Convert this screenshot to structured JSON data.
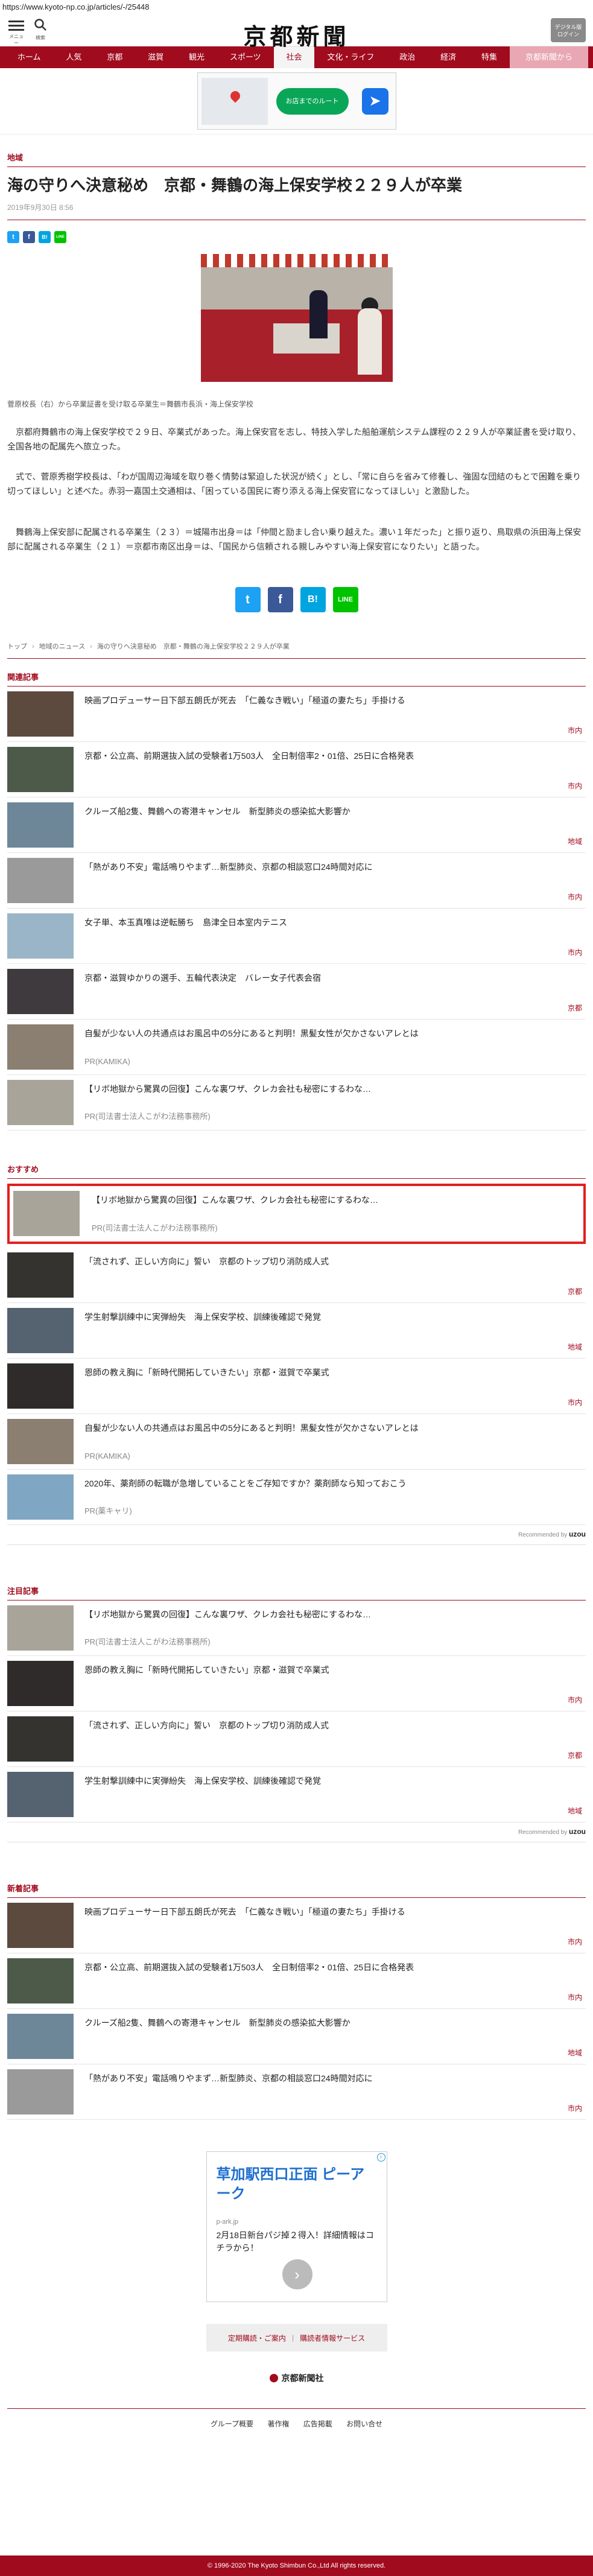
{
  "url": "https://www.kyoto-np.co.jp/articles/-/25448",
  "header": {
    "menu_label": "メニュー",
    "search_label": "検索",
    "logo": "京都新聞",
    "digital_label_1": "デジタル版",
    "digital_label_2": "ログイン"
  },
  "nav": [
    "ホーム",
    "人気",
    "京都",
    "滋賀",
    "観光",
    "スポーツ",
    "社会",
    "文化・ライフ",
    "政治",
    "経済",
    "特集",
    "京都新聞から"
  ],
  "ad_top": {
    "pill": "お店までのルート",
    "map_label": "スマートフォン"
  },
  "article": {
    "category": "地域",
    "title": "海の守りへ決意秘め　京都・舞鶴の海上保安学校２２９人が卒業",
    "date": "2019年9月30日 8:56",
    "caption": "菅原校長（右）から卒業証書を受け取る卒業生＝舞鶴市長浜・海上保安学校",
    "paragraphs": [
      "京都府舞鶴市の海上保安学校で２９日、卒業式があった。海上保安官を志し、特技入学した船舶運航システム課程の２２９人が卒業証書を受け取り、全国各地の配属先へ旅立った。",
      "式で、菅原秀樹学校長は、「わが国周辺海域を取り巻く情勢は緊迫した状況が続く」とし、「常に自らを省みて修養し、強固な団結のもとで困難を乗り切ってほしい」と述べた。赤羽一嘉国土交通相は、「困っている国民に寄り添える海上保安官になってほしい」と激励した。",
      "舞鶴海上保安部に配属される卒業生（２３）＝城陽市出身＝は「仲間と励まし合い乗り越えた。濃い１年だった」と振り返り、鳥取県の浜田海上保安部に配属される卒業生（２１）＝京都市南区出身＝は、「国民から信頼される親しみやすい海上保安官になりたい」と語った。"
    ]
  },
  "share": {
    "twitter": "t",
    "facebook": "f",
    "hatena": "B!",
    "line": "LINE"
  },
  "breadcrumb": [
    "トップ",
    "地域のニュース",
    "海の守りへ決意秘め　京都・舞鶴の海上保安学校２２９人が卒業"
  ],
  "related": {
    "heading": "関連記事",
    "items": [
      {
        "title": "映画プロデューサー日下部五朗氏が死去　「仁義なき戦い」「極道の妻たち」手掛ける",
        "tag": "市内"
      },
      {
        "title": "京都・公立高、前期選抜入試の受験者1万503人　全日制倍率2・01倍、25日に合格発表",
        "tag": "市内"
      },
      {
        "title": "クルーズ船2隻、舞鶴への寄港キャンセル　新型肺炎の感染拡大影響か",
        "tag": "地域"
      },
      {
        "title": "「熱があり不安」電話鳴りやまず…新型肺炎、京都の相談窓口24時間対応に",
        "tag": "市内"
      },
      {
        "title": "女子単、本玉真唯は逆転勝ち　島津全日本室内テニス",
        "tag": "市内"
      },
      {
        "title": "京都・滋賀ゆかりの選手、五輪代表決定　バレー女子代表会宿",
        "tag": "京都"
      },
      {
        "title": "自髪が少ない人の共通点はお風呂中の5分にあると判明！黒髪女性が欠かさないアレとは",
        "pr": "PR(KAMIKA)"
      },
      {
        "title": "【リボ地獄から驚異の回復】こんな裏ワザ、クレカ会社も秘密にするわな…",
        "pr": "PR(司法書士法人こがわ法務事務所)"
      }
    ]
  },
  "recommend": {
    "heading": "おすすめ",
    "items": [
      {
        "title": "【リボ地獄から驚異の回復】こんな裏ワザ、クレカ会社も秘密にするわな…",
        "pr": "PR(司法書士法人こがわ法務事務所)"
      },
      {
        "title": "「流されず、正しい方向に」誓い　京都のトップ切り消防成人式",
        "tag": "京都"
      },
      {
        "title": "学生射撃訓練中に実弾紛失　海上保安学校、訓練後確認で発覚",
        "tag": "地域"
      },
      {
        "title": "恩師の教え胸に「新時代開拓していきたい」京都・滋賀で卒業式",
        "tag": "市内"
      },
      {
        "title": "自髪が少ない人の共通点はお風呂中の5分にあると判明！黒髪女性が欠かさないアレとは",
        "pr": "PR(KAMIKA)"
      },
      {
        "title": "2020年、薬剤師の転職が急増していることをご存知ですか？薬剤師なら知っておこう",
        "pr": "PR(薬キャリ)"
      }
    ],
    "credit": "Recommended by",
    "brand": "uzou"
  },
  "attention": {
    "heading": "注目記事",
    "items": [
      {
        "title": "【リボ地獄から驚異の回復】こんな裏ワザ、クレカ会社も秘密にするわな…",
        "pr": "PR(司法書士法人こがわ法務事務所)"
      },
      {
        "title": "恩師の教え胸に「新時代開拓していきたい」京都・滋賀で卒業式",
        "tag": "市内"
      },
      {
        "title": "「流されず、正しい方向に」誓い　京都のトップ切り消防成人式",
        "tag": "京都"
      },
      {
        "title": "学生射撃訓練中に実弾紛失　海上保安学校、訓練後確認で発覚",
        "tag": "地域"
      }
    ],
    "credit": "Recommended by",
    "brand": "uzou"
  },
  "latest": {
    "heading": "新着記事",
    "items": [
      {
        "title": "映画プロデューサー日下部五朗氏が死去　「仁義なき戦い」「極道の妻たち」手掛ける",
        "tag": "市内"
      },
      {
        "title": "京都・公立高、前期選抜入試の受験者1万503人　全日制倍率2・01倍、25日に合格発表",
        "tag": "市内"
      },
      {
        "title": "クルーズ船2隻、舞鶴への寄港キャンセル　新型肺炎の感染拡大影響か",
        "tag": "地域"
      },
      {
        "title": "「熱があり不安」電話鳴りやまず…新型肺炎、京都の相談窓口24時間対応に",
        "tag": "市内"
      }
    ]
  },
  "ad_bottom": {
    "headline": "草加駅西口正面 ピーアーク",
    "small": "p-ark.jp",
    "desc": "2月18日新台パジ掉２得入！詳細情報はコチラから！",
    "arrow": "›",
    "adchoice": "i"
  },
  "footer": {
    "links": [
      "定期購読・ご案内",
      "購読者情報サービス"
    ],
    "separator": "|",
    "company": "京都新聞社",
    "nav": [
      "グループ概要",
      "著作権",
      "広告掲載",
      "お問い合せ"
    ],
    "copyright": "© 1996-2020 The Kyoto Shimbun Co.,Ltd All rights reserved."
  },
  "colors": {
    "brand": "#a10b1e",
    "highlight": "#e02020",
    "twitter": "#1da1f2",
    "facebook": "#3b5998",
    "hatena": "#00a4de",
    "line": "#00c300"
  }
}
